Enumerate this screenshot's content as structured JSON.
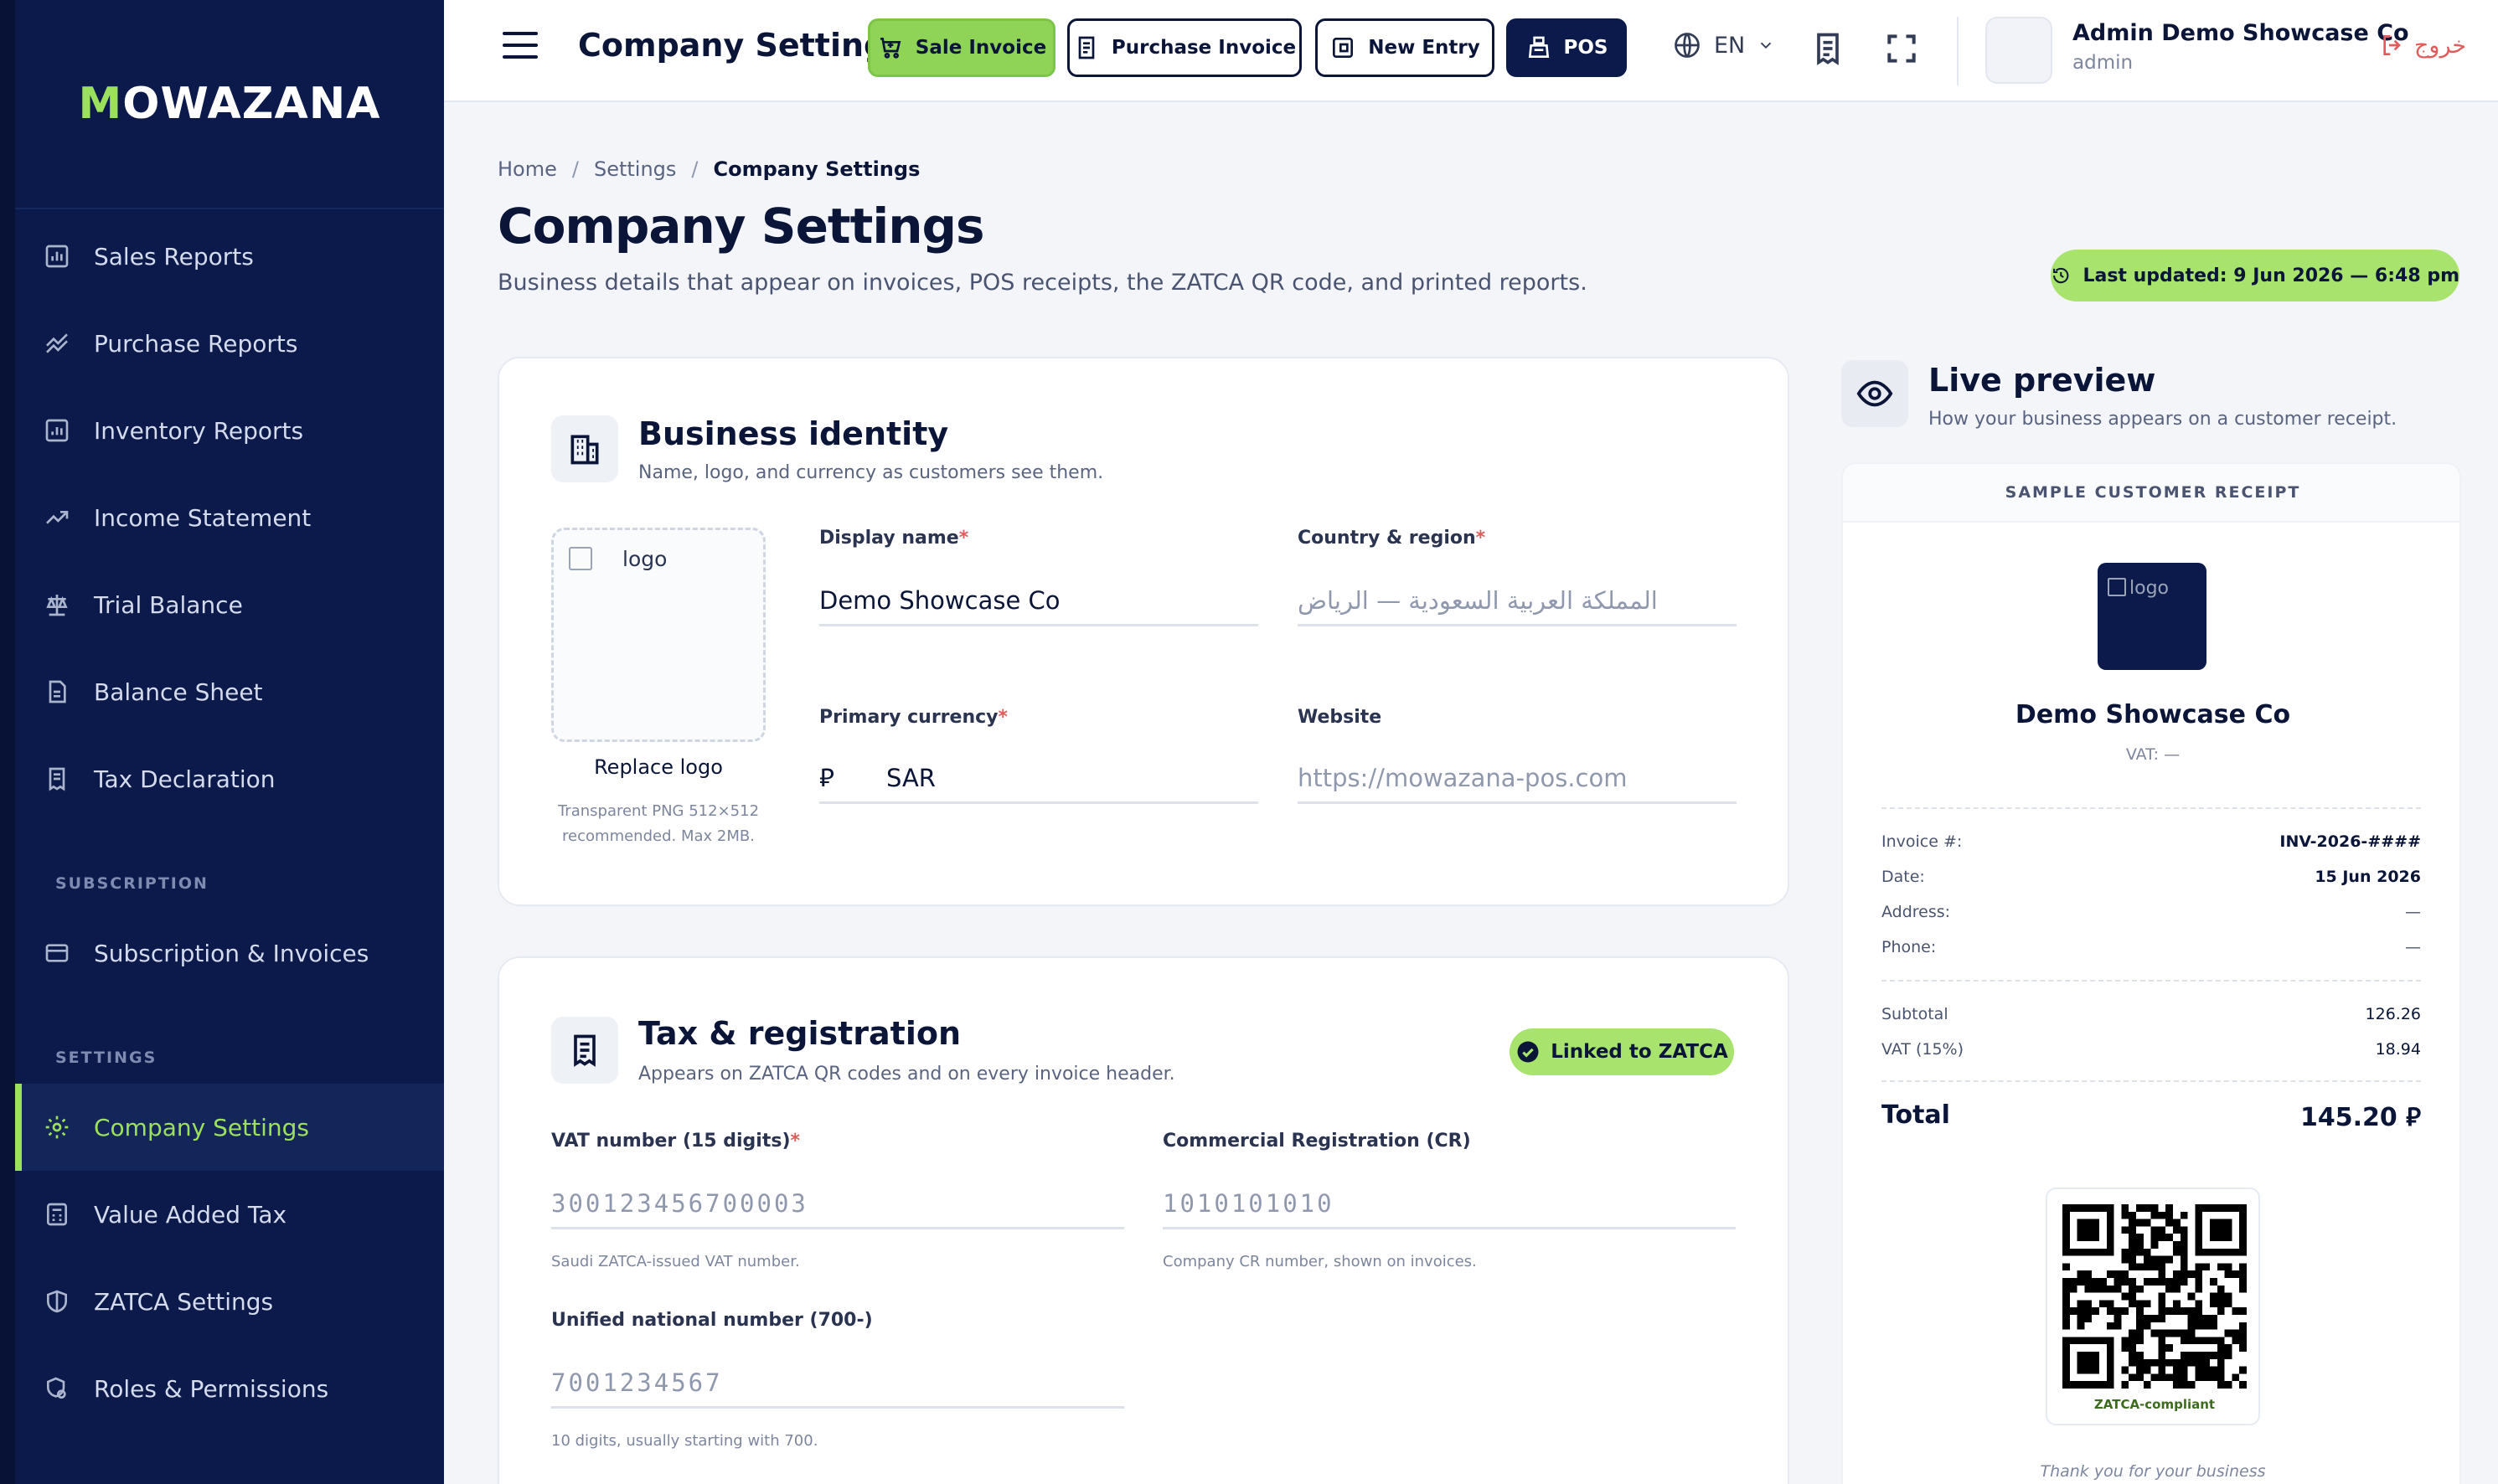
{
  "brand": {
    "name_accent": "M",
    "name_rest": "OWAZANA"
  },
  "sidebar": {
    "items": [
      {
        "label": "Sales Reports",
        "icon": "bar-chart-icon"
      },
      {
        "label": "Purchase Reports",
        "icon": "trend-lines-icon"
      },
      {
        "label": "Inventory Reports",
        "icon": "bar-chart-icon"
      },
      {
        "label": "Income Statement",
        "icon": "trend-up-icon"
      },
      {
        "label": "Trial Balance",
        "icon": "scale-icon"
      },
      {
        "label": "Balance Sheet",
        "icon": "document-icon"
      },
      {
        "label": "Tax Declaration",
        "icon": "receipt-icon"
      }
    ],
    "section_subscription": "SUBSCRIPTION",
    "subscription_items": [
      {
        "label": "Subscription & Invoices",
        "icon": "card-icon"
      }
    ],
    "section_settings": "SETTINGS",
    "settings_items": [
      {
        "label": "Company Settings",
        "icon": "gear-icon",
        "active": true
      },
      {
        "label": "Value Added Tax",
        "icon": "calculator-icon"
      },
      {
        "label": "ZATCA Settings",
        "icon": "shield-icon"
      },
      {
        "label": "Roles & Permissions",
        "icon": "user-shield-icon"
      }
    ],
    "accent_color": "#9be15d",
    "bg_color": "#0b1a4a"
  },
  "topbar": {
    "title": "Company Settings",
    "buttons": {
      "sale_invoice": "Sale Invoice",
      "purchase_invoice": "Purchase Invoice",
      "new_entry": "New Entry",
      "pos": "POS"
    },
    "language": "EN",
    "user": {
      "name": "Admin Demo Showcase Co",
      "role": "admin"
    },
    "logout": "خروج"
  },
  "breadcrumb": {
    "home": "Home",
    "settings": "Settings",
    "current": "Company Settings"
  },
  "page": {
    "title": "Company Settings",
    "subtitle": "Business details that appear on invoices, POS receipts, the ZATCA QR code, and printed reports.",
    "last_updated": "Last updated: 9 Jun 2026 — 6:48 pm"
  },
  "identity": {
    "title": "Business identity",
    "subtitle": "Name, logo, and currency as customers see them.",
    "logo_alt": "logo",
    "replace_logo": "Replace logo",
    "logo_hint_1": "Transparent PNG 512×512",
    "logo_hint_2": "recommended. Max 2MB.",
    "display_name_label": "Display name",
    "display_name_value": "Demo Showcase Co",
    "country_label": "Country & region",
    "country_placeholder": "المملكة العربية السعودية — الرياض",
    "currency_label": "Primary currency",
    "currency_symbol": "⃁",
    "currency_value": "SAR",
    "website_label": "Website",
    "website_placeholder": "https://mowazana-pos.com",
    "required_mark": "*"
  },
  "tax": {
    "title": "Tax & registration",
    "subtitle": "Appears on ZATCA QR codes and on every invoice header.",
    "badge": "Linked to ZATCA",
    "vat_label": "VAT number (15 digits)",
    "vat_placeholder": "300123456700003",
    "vat_hint": "Saudi ZATCA-issued VAT number.",
    "cr_label": "Commercial Registration (CR)",
    "cr_placeholder": "1010101010",
    "cr_hint": "Company CR number, shown on invoices.",
    "unified_label": "Unified national number (700-)",
    "unified_placeholder": "7001234567",
    "unified_hint": "10 digits, usually starting with 700."
  },
  "preview": {
    "title": "Live preview",
    "subtitle": "How your business appears on a customer receipt.",
    "receipt_header": "SAMPLE CUSTOMER RECEIPT",
    "logo_alt": "logo",
    "company": "Demo Showcase Co",
    "vat_line": "VAT: —",
    "rows": [
      {
        "label": "Invoice #:",
        "value": "INV-2026-####",
        "bold": true
      },
      {
        "label": "Date:",
        "value": "15 Jun 2026",
        "bold": true
      },
      {
        "label": "Address:",
        "value": "—",
        "bold": false
      },
      {
        "label": "Phone:",
        "value": "—",
        "bold": false
      }
    ],
    "subtotal_label": "Subtotal",
    "subtotal_value": "126.26",
    "vat_label": "VAT (15%)",
    "vat_value": "18.94",
    "total_label": "Total",
    "total_value": "145.20 ⃁",
    "qr_label": "ZATCA-compliant",
    "thanks": "Thank you for your business"
  }
}
